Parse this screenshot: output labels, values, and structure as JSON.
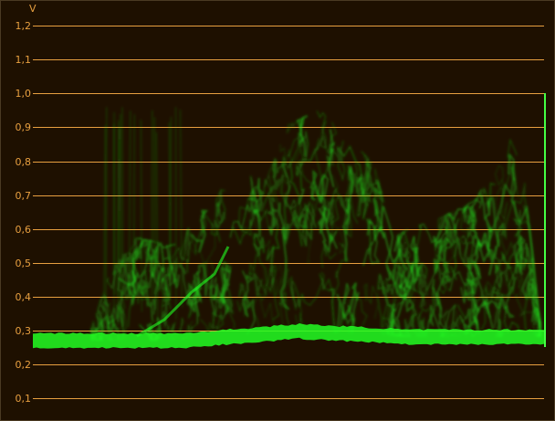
{
  "scope": {
    "unit": "V",
    "tick_labels": [
      "1,2",
      "1,1",
      "1,0",
      "0,9",
      "0,8",
      "0,7",
      "0,6",
      "0,5",
      "0,4",
      "0,3",
      "0,2",
      "0,1"
    ],
    "tick_values": [
      1.2,
      1.1,
      1.0,
      0.9,
      0.8,
      0.7,
      0.6,
      0.5,
      0.4,
      0.3,
      0.2,
      0.1
    ],
    "colors": {
      "background": "#1e1000",
      "graticule": "#e8a040",
      "trace": "#22ff22"
    }
  }
}
